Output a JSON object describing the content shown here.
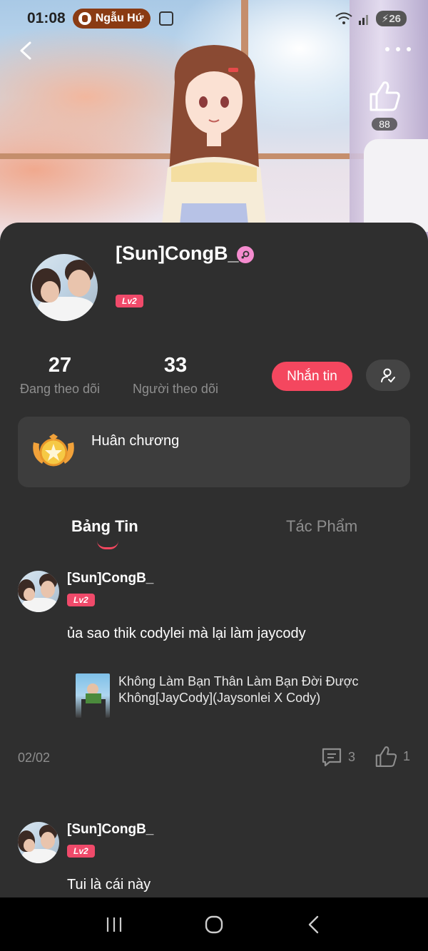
{
  "status_bar": {
    "time": "01:08",
    "notification": "Ngẫu Hứ",
    "battery": "26"
  },
  "header": {
    "like_count": "88"
  },
  "profile": {
    "name": "[Sun]CongB_",
    "level": "Lv2",
    "following_count": "27",
    "following_label": "Đang theo dõi",
    "followers_count": "33",
    "followers_label": "Người theo dõi",
    "message_button": "Nhắn tin",
    "medal_label": "Huân chương"
  },
  "tabs": [
    {
      "label": "Bảng Tin",
      "active": true
    },
    {
      "label": "Tác Phẩm",
      "active": false
    }
  ],
  "posts": [
    {
      "author": "[Sun]CongB_",
      "level": "Lv2",
      "text": "ủa sao thik codylei mà lại làm jaycody",
      "work_title_line1": "Không Làm Bạn Thân Làm Bạn Đời Được",
      "work_title_line2": "Không[JayCody](Jaysonlei X Cody)",
      "date": "02/02",
      "comment_count": "3",
      "like_count": "1"
    },
    {
      "author": "[Sun]CongB_",
      "level": "Lv2",
      "text": "Tui là cái này"
    }
  ],
  "colors": {
    "accent": "#f4475f",
    "background": "#2f2f2f",
    "card": "#3d3d3d"
  }
}
